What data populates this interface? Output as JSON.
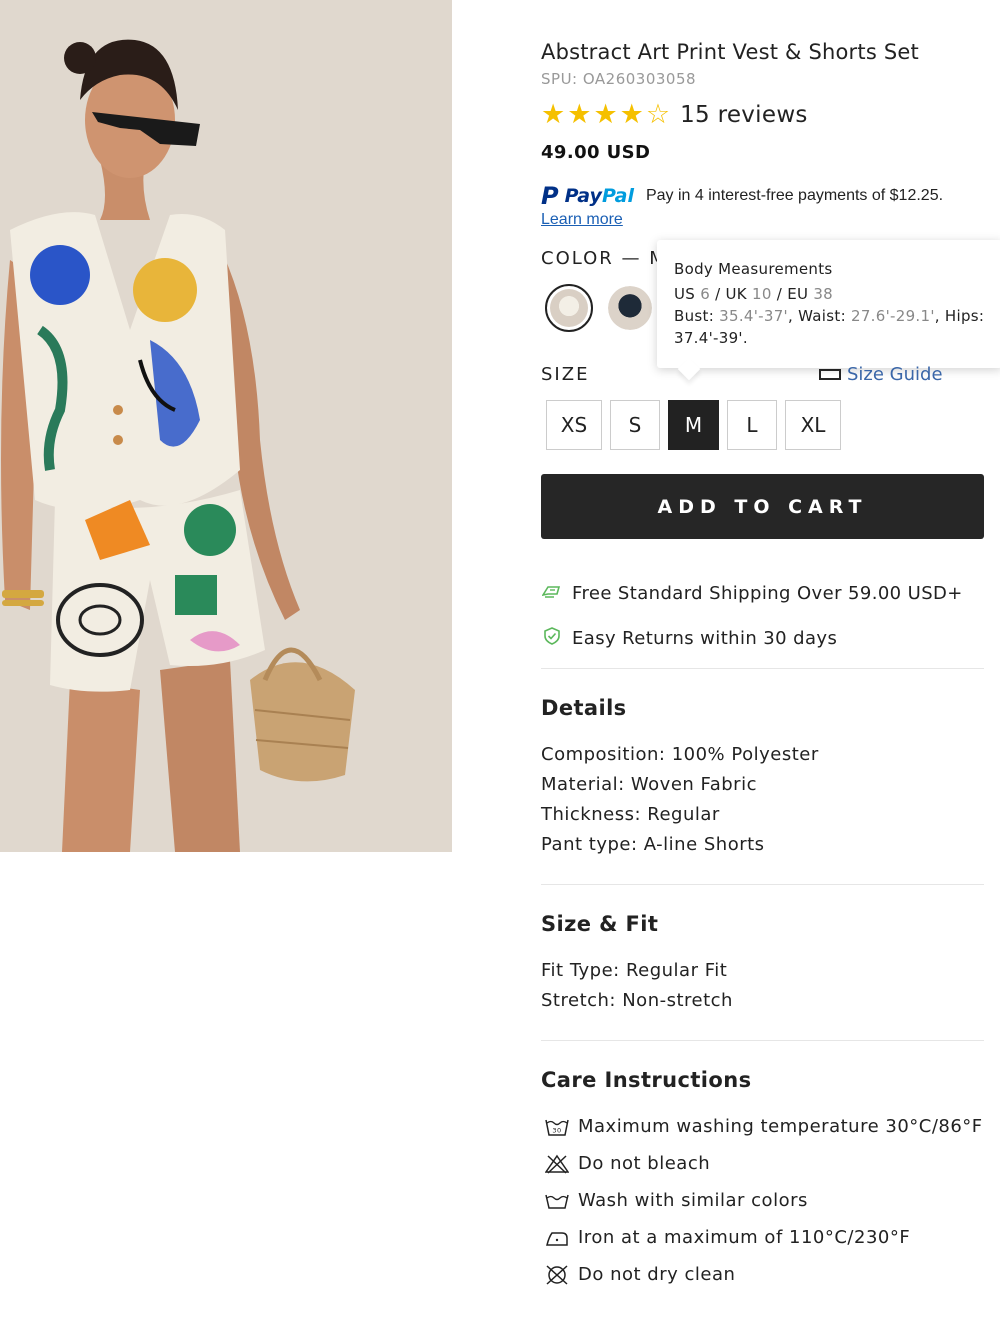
{
  "product": {
    "title": "Abstract Art Print Vest & Shorts Set",
    "spu": "SPU: OA260303058",
    "rating": 4,
    "rating_max": 5,
    "reviews": "15 reviews",
    "price": "49.00 USD"
  },
  "paypal": {
    "p": "P",
    "pay": "Pay",
    "pal": "Pal",
    "text": "Pay in 4 interest-free payments of $12.25.",
    "learn_more": "Learn more"
  },
  "color": {
    "label": "COLOR — M"
  },
  "tooltip": {
    "title": "Body Measurements",
    "line1_a": "US",
    "line1_b": "6",
    "line1_c": " / UK",
    "line1_d": "10",
    "line1_e": " / EU",
    "line1_f": "38",
    "line2_a": "Bust:",
    "line2_b": "35.4'-37'",
    "line2_c": ", Waist:",
    "line2_d": "27.6'-29.1'",
    "line2_e": ", Hips:",
    "line3": "37.4'-39'."
  },
  "size": {
    "label": "SIZE",
    "guide": "Size Guide",
    "options": [
      "XS",
      "S",
      "M",
      "L",
      "XL"
    ],
    "selected": "M"
  },
  "cart": {
    "label": "ADD TO CART"
  },
  "perks": [
    {
      "icon": "truck-icon",
      "text": "Free Standard Shipping Over 59.00 USD+"
    },
    {
      "icon": "shield-check-icon",
      "text": "Easy Returns within 30 days"
    }
  ],
  "details": {
    "title": "Details",
    "lines": [
      "Composition: 100% Polyester",
      "Material: Woven Fabric",
      "Thickness: Regular",
      "Pant type: A-line Shorts"
    ]
  },
  "size_fit": {
    "title": "Size & Fit",
    "lines": [
      "Fit Type: Regular Fit",
      "Stretch: Non-stretch"
    ]
  },
  "care": {
    "title": "Care Instructions",
    "items": [
      {
        "icon": "wash-30-icon",
        "text": "Maximum washing temperature 30°C/86°F"
      },
      {
        "icon": "no-bleach-icon",
        "text": "Do not bleach"
      },
      {
        "icon": "wash-tub-icon",
        "text": "Wash with similar colors"
      },
      {
        "icon": "iron-icon",
        "text": "Iron at a maximum of 110°C/230°F"
      },
      {
        "icon": "no-dry-clean-icon",
        "text": "Do not dry clean"
      }
    ]
  },
  "colors": {
    "accent_dark": "#262626",
    "star": "#f5c000",
    "link": "#1a5fb4",
    "perk_green": "#5cb85c"
  }
}
